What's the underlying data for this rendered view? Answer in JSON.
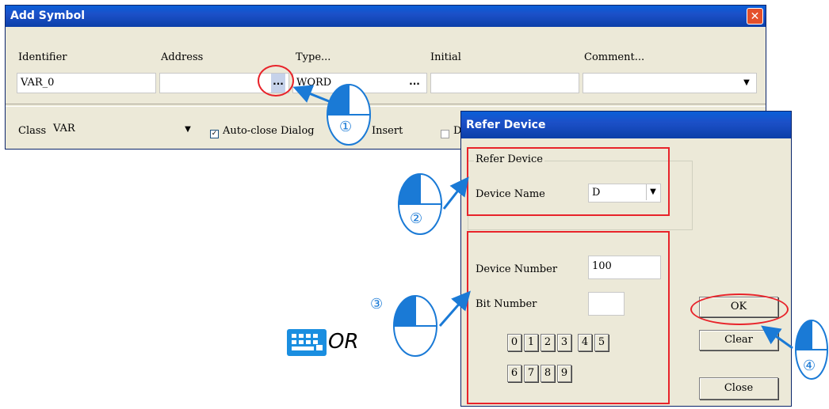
{
  "add_symbol": {
    "title": "Add Symbol",
    "close_glyph": "✕",
    "labels": {
      "identifier": "Identifier",
      "address": "Address",
      "type": "Type...",
      "initial": "Initial",
      "comment": "Comment..."
    },
    "values": {
      "identifier": "VAR_0",
      "address": "",
      "type": "WORD",
      "initial": "",
      "comment": ""
    },
    "ellipsis": "...",
    "class_label": "Class",
    "class_value": "VAR",
    "auto_close_label": "Auto-close Dialog",
    "auto_close_checked": "✓",
    "insert_label": "Insert",
    "partial_label": "D"
  },
  "refer_device": {
    "title": "Refer Device",
    "group_title": "Refer Device",
    "device_name_label": "Device Name",
    "device_name_value": "D",
    "device_number_label": "Device Number",
    "device_number_value": "100",
    "bit_number_label": "Bit Number",
    "bit_number_value": "",
    "keys_row1": [
      "0",
      "1",
      "2",
      "3",
      "4",
      "5"
    ],
    "keys_row2": [
      "6",
      "7",
      "8",
      "9"
    ],
    "ok": "OK",
    "clear": "Clear",
    "close": "Close"
  },
  "annotations": {
    "step1": "①",
    "step2": "②",
    "step3": "③",
    "step4": "④",
    "or_text": "OR"
  },
  "colors": {
    "title_blue": "#1c50c8",
    "highlight_red": "#e8232a",
    "callout_blue": "#1a7ad6",
    "dialog_bg": "#ece9d8"
  },
  "icons": [
    "mouse-icon",
    "keyboard-icon",
    "dropdown-arrow-icon",
    "close-icon",
    "checkbox-icon"
  ]
}
